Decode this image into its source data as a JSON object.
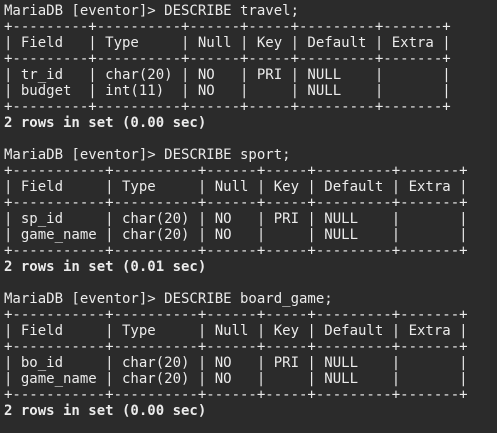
{
  "colors": {
    "background": "#2b2b2b",
    "text": "#ebebeb"
  },
  "blocks": [
    {
      "command": "MariaDB [eventor]> DESCRIBE travel;",
      "border": "+---------+----------+------+-----+---------+-------+",
      "header": "| Field   | Type     | Null | Key | Default | Extra |",
      "rows": [
        "| tr_id   | char(20) | NO   | PRI | NULL    |       |",
        "| budget  | int(11)  | NO   |     | NULL    |       |"
      ],
      "result": "2 rows in set (0.00 sec)"
    },
    {
      "command": "MariaDB [eventor]> DESCRIBE sport;",
      "border": "+-----------+----------+------+-----+---------+-------+",
      "header": "| Field     | Type     | Null | Key | Default | Extra |",
      "rows": [
        "| sp_id     | char(20) | NO   | PRI | NULL    |       |",
        "| game_name | char(20) | NO   |     | NULL    |       |"
      ],
      "result": "2 rows in set (0.01 sec)"
    },
    {
      "command": "MariaDB [eventor]> DESCRIBE board_game;",
      "border": "+-----------+----------+------+-----+---------+-------+",
      "header": "| Field     | Type     | Null | Key | Default | Extra |",
      "rows": [
        "| bo_id     | char(20) | NO   | PRI | NULL    |       |",
        "| game_name | char(20) | NO   |     | NULL    |       |"
      ],
      "result": "2 rows in set (0.00 sec)"
    }
  ]
}
